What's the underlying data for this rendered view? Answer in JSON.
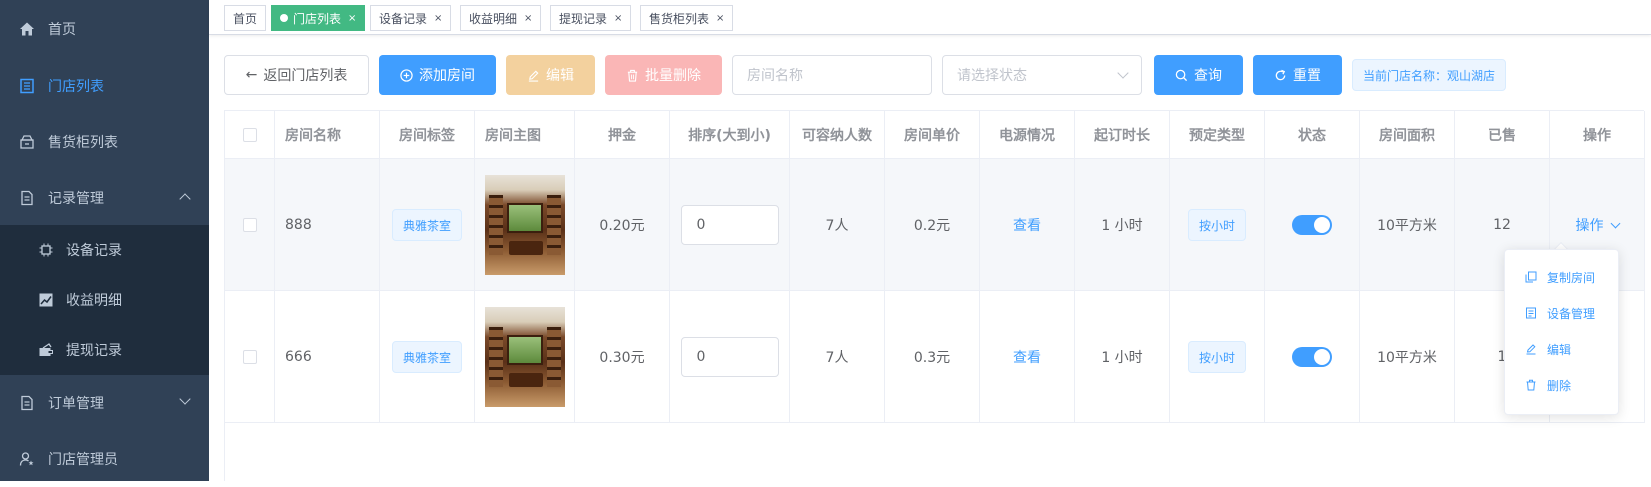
{
  "sidebar": {
    "home": "首页",
    "store_list": "门店列表",
    "cabinet_list": "售货柜列表",
    "record_mgmt": "记录管理",
    "device_record": "设备记录",
    "income_detail": "收益明细",
    "withdraw_record": "提现记录",
    "order_mgmt": "订单管理",
    "store_admin": "门店管理员"
  },
  "tags": {
    "home": "首页",
    "store_list": "门店列表",
    "device_record": "设备记录",
    "income_detail": "收益明细",
    "withdraw_record": "提现记录",
    "cabinet_list": "售货柜列表",
    "close": "×"
  },
  "toolbar": {
    "back": "返回门店列表",
    "add_room": "添加房间",
    "edit": "编辑",
    "batch_delete": "批量删除",
    "room_name_placeholder": "房间名称",
    "status_placeholder": "请选择状态",
    "query": "查询",
    "reset": "重置",
    "current_store": "当前门店名称：观山湖店"
  },
  "table": {
    "headers": [
      "房间名称",
      "房间标签",
      "房间主图",
      "押金",
      "排序(大到小)",
      "可容纳人数",
      "房间单价",
      "电源情况",
      "起订时长",
      "预定类型",
      "状态",
      "房间面积",
      "已售",
      "操作"
    ],
    "rows": [
      {
        "name": "888",
        "tag": "典雅茶室",
        "deposit": "0.20元",
        "sort": "0",
        "capacity": "7人",
        "price": "0.2元",
        "power": "查看",
        "min_duration": "1 小时",
        "book_type": "按小时",
        "status_on": true,
        "area": "10平方米",
        "sold": "12",
        "action": "操作"
      },
      {
        "name": "666",
        "tag": "典雅茶室",
        "deposit": "0.30元",
        "sort": "0",
        "capacity": "7人",
        "price": "0.3元",
        "power": "查看",
        "min_duration": "1 小时",
        "book_type": "按小时",
        "status_on": true,
        "area": "10平方米",
        "sold": "1"
      }
    ]
  },
  "dropdown": {
    "copy_room": "复制房间",
    "device_mgmt": "设备管理",
    "edit": "编辑",
    "delete": "删除"
  },
  "colors": {
    "primary": "#409eff",
    "sidebar_bg": "#304156",
    "active_tag": "#42b983",
    "warning": "#f3d19e",
    "danger": "#fab6b6"
  }
}
